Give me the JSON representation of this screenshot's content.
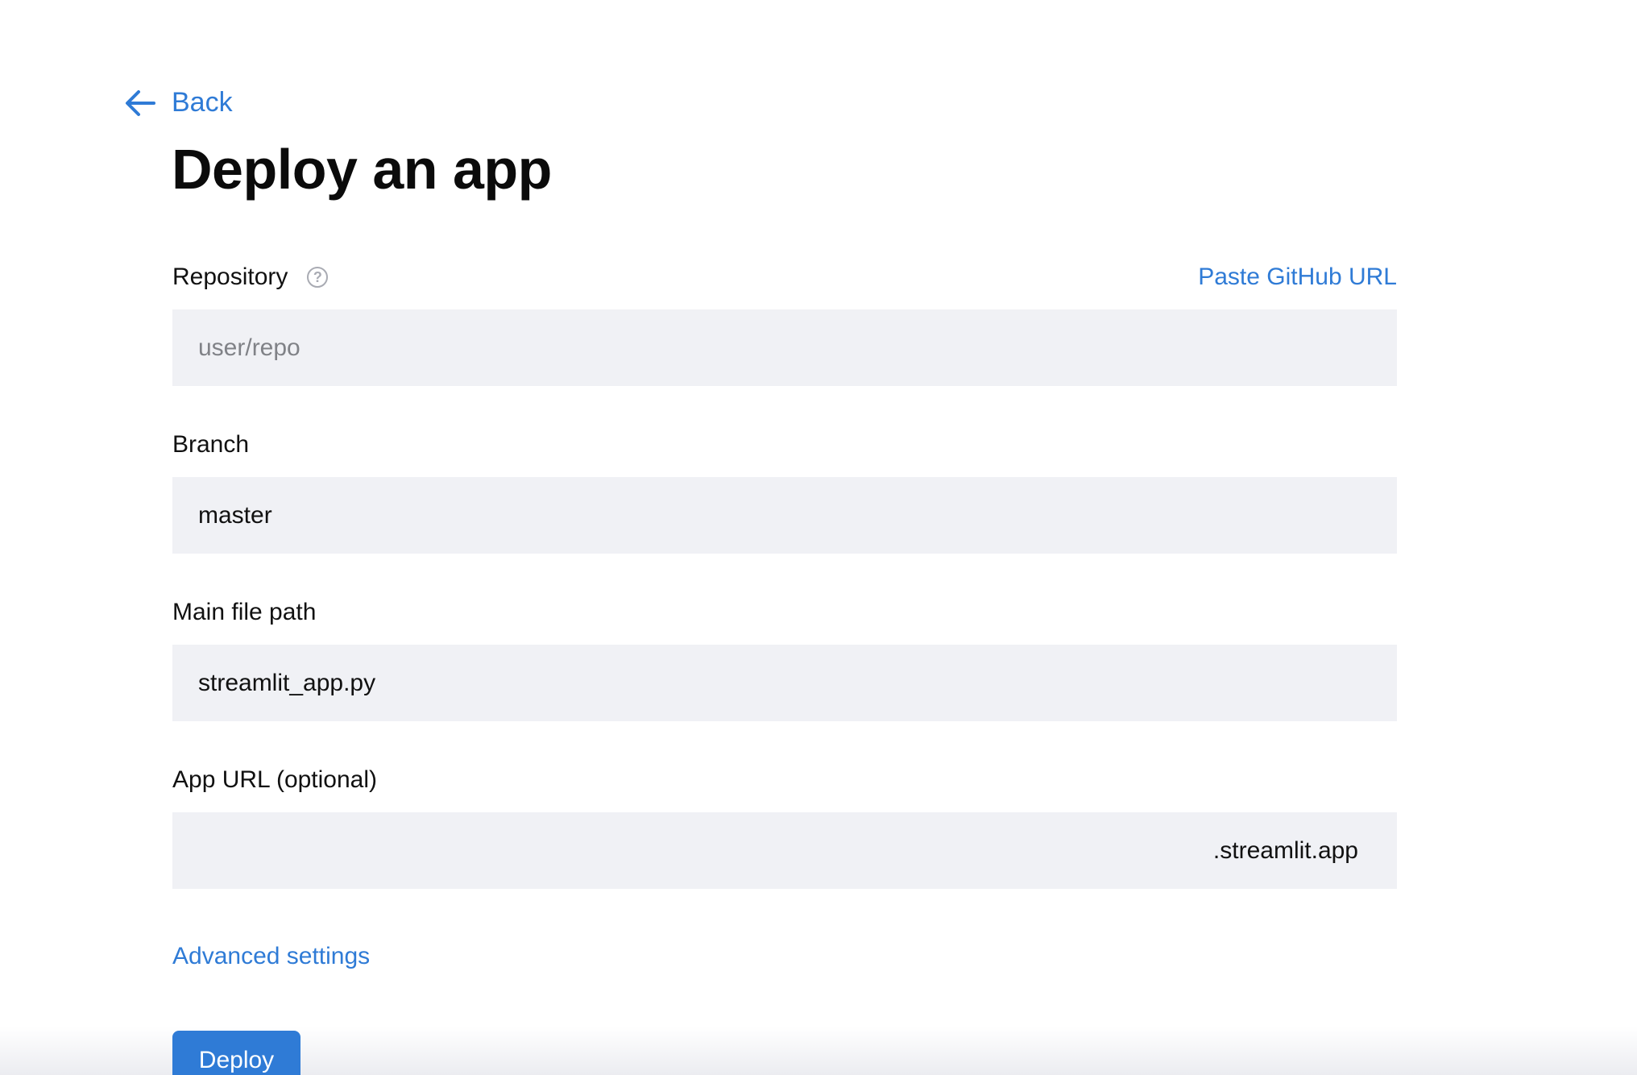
{
  "nav": {
    "back_label": "Back",
    "back_icon": "arrow-left-icon"
  },
  "page": {
    "title": "Deploy an app"
  },
  "repository": {
    "label": "Repository",
    "help_icon": "question-circle-icon",
    "help_glyph": "?",
    "paste_link": "Paste GitHub URL",
    "placeholder": "user/repo"
  },
  "branch": {
    "label": "Branch",
    "value": "master"
  },
  "main_file": {
    "label": "Main file path",
    "value": "streamlit_app.py"
  },
  "app_url": {
    "label": "App URL (optional)",
    "value": "",
    "suffix": ".streamlit.app"
  },
  "advanced_settings": "Advanced settings",
  "deploy_button": "Deploy",
  "colors": {
    "accent": "#2f7bd6",
    "field_bg": "#f0f1f5",
    "text": "#111111",
    "placeholder": "#808287"
  }
}
